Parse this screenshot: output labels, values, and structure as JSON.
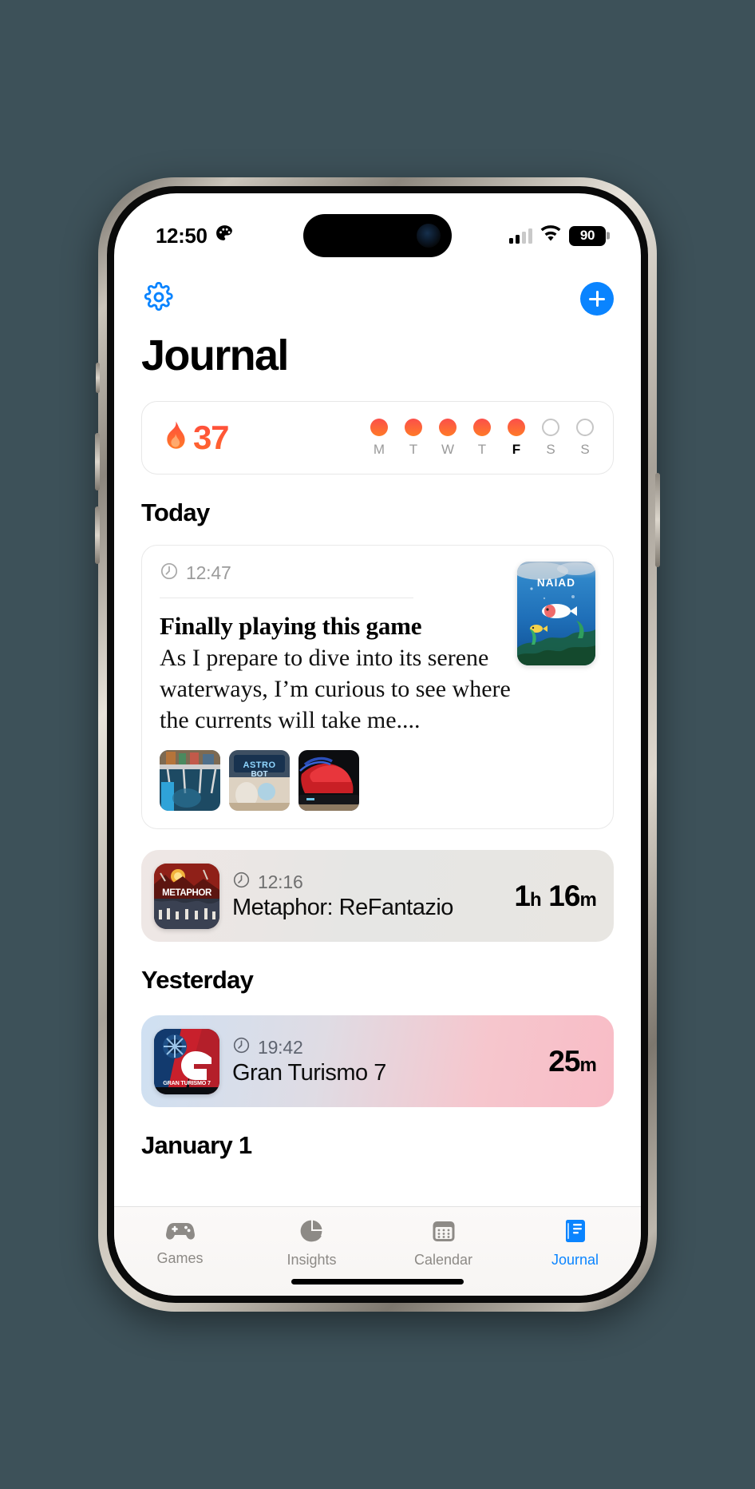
{
  "status_bar": {
    "time": "12:50",
    "palette_icon": "palette-icon",
    "signal_icon": "cellular-signal-icon",
    "signal_bars_filled": 2,
    "signal_bars_total": 4,
    "wifi_icon": "wifi-icon",
    "battery_level": "90",
    "battery_icon": "battery-icon"
  },
  "navbar": {
    "settings_icon": "gear-icon",
    "add_icon": "plus-icon",
    "accent_color": "#0a84ff"
  },
  "header": {
    "title": "Journal"
  },
  "streak": {
    "flame_icon": "flame-icon",
    "count": "37",
    "gradient_from": "#ff4b3e",
    "gradient_to": "#ff6a2b",
    "days": [
      {
        "label": "M",
        "filled": true,
        "today": false
      },
      {
        "label": "T",
        "filled": true,
        "today": false
      },
      {
        "label": "W",
        "filled": true,
        "today": false
      },
      {
        "label": "T",
        "filled": true,
        "today": false
      },
      {
        "label": "F",
        "filled": true,
        "today": true
      },
      {
        "label": "S",
        "filled": false,
        "today": false
      },
      {
        "label": "S",
        "filled": false,
        "today": false
      }
    ]
  },
  "sections": {
    "today": "Today",
    "yesterday": "Yesterday",
    "january_1": "January 1"
  },
  "note_entry": {
    "clock_icon": "clock-icon",
    "time": "12:47",
    "title": "Finally playing this game",
    "body": "As I prepare to dive into its serene waterways, I’m curious to see where the currents will take me....",
    "cover_name": "NAIAD",
    "cover_title_text": "NAIAD",
    "thumbnails": [
      {
        "name": "thumbnail-workbench"
      },
      {
        "name": "thumbnail-astro-bot",
        "text": "ASTRO BOT"
      },
      {
        "name": "thumbnail-red-car"
      }
    ]
  },
  "sessions": [
    {
      "name": "metaphor-refantazio",
      "clock_icon": "clock-icon",
      "time": "12:16",
      "title": "Metaphor: ReFantazio",
      "cover_text": "METAPHOR",
      "duration_value_1": "1",
      "duration_unit_1": "h",
      "duration_value_2": "16",
      "duration_unit_2": "m"
    },
    {
      "name": "gran-turismo-7",
      "clock_icon": "clock-icon",
      "time": "19:42",
      "title": "Gran Turismo 7",
      "cover_text": "GRAN TURISMO 7",
      "duration_value_1": "25",
      "duration_unit_1": "m",
      "duration_value_2": "",
      "duration_unit_2": ""
    }
  ],
  "tabbar": {
    "tabs": [
      {
        "label": "Games",
        "icon": "gamepad-icon",
        "active": false
      },
      {
        "label": "Insights",
        "icon": "piechart-icon",
        "active": false
      },
      {
        "label": "Calendar",
        "icon": "calendar-icon",
        "active": false
      },
      {
        "label": "Journal",
        "icon": "book-icon",
        "active": true
      }
    ],
    "active_color": "#0a84ff",
    "inactive_color": "#8d8a86"
  }
}
